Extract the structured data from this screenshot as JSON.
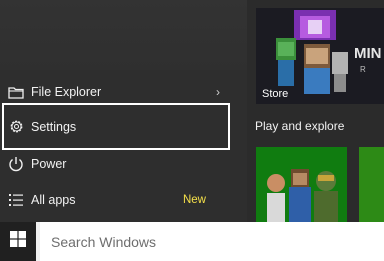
{
  "start_menu": {
    "items": [
      {
        "label": "File Explorer",
        "icon": "folder-icon",
        "has_arrow": true
      },
      {
        "label": "Settings",
        "icon": "gear-icon",
        "selected": true
      },
      {
        "label": "Power",
        "icon": "power-icon"
      },
      {
        "label": "All apps",
        "icon": "list-icon",
        "badge": "New"
      }
    ]
  },
  "tiles": {
    "store_label": "Store",
    "group_label": "Play and explore"
  },
  "taskbar": {
    "search_placeholder": "Search Windows"
  },
  "colors": {
    "accent_green": "#107c10",
    "new_badge": "#f5e04a",
    "focus_border": "#ffffff"
  }
}
